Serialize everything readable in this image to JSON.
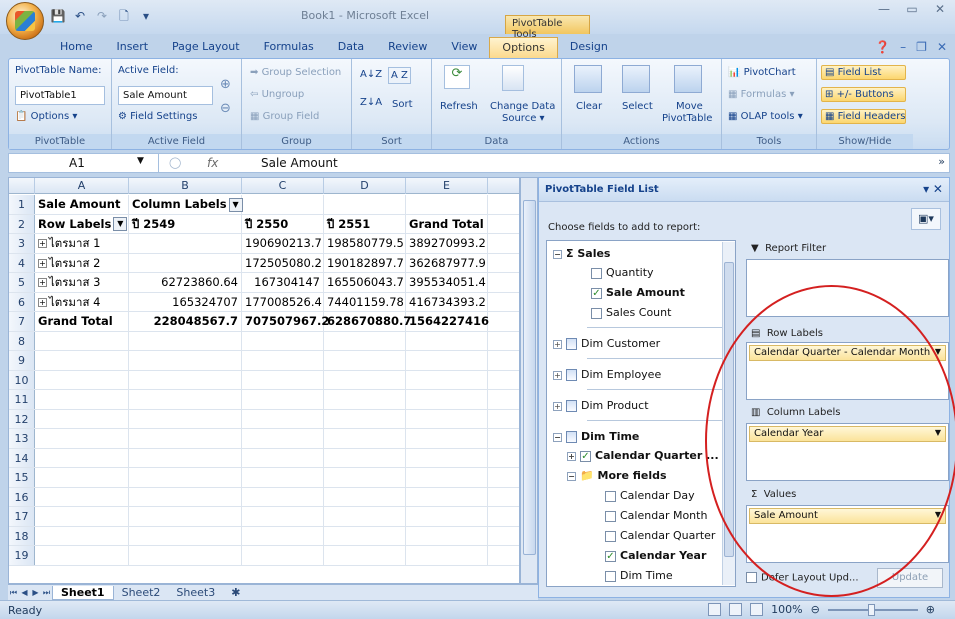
{
  "window": {
    "title": "Book1 - Microsoft Excel",
    "context_tab_header": "PivotTable Tools",
    "controls": [
      "—",
      "▭",
      "✕"
    ]
  },
  "tabs": [
    "Home",
    "Insert",
    "Page Layout",
    "Formulas",
    "Data",
    "Review",
    "View",
    "Options",
    "Design"
  ],
  "active_tab": "Options",
  "ribbon": {
    "pivottable": {
      "name_label": "PivotTable Name:",
      "name_value": "PivotTable1",
      "options_label": "Options",
      "group_label": "PivotTable"
    },
    "active_field": {
      "label": "Active Field:",
      "value": "Sale Amount",
      "settings_label": "Field Settings",
      "group_label": "Active Field"
    },
    "group": {
      "selection": "Group Selection",
      "ungroup": "Ungroup",
      "field": "Group Field",
      "group_label": "Group"
    },
    "sort": {
      "sort_label": "Sort",
      "group_label": "Sort"
    },
    "data": {
      "refresh": "Refresh",
      "change_source": "Change Data",
      "change_source_2": "Source",
      "group_label": "Data"
    },
    "actions": {
      "clear": "Clear",
      "select": "Select",
      "move": "Move",
      "move_2": "PivotTable",
      "group_label": "Actions"
    },
    "tools": {
      "pivotchart": "PivotChart",
      "formulas": "Formulas",
      "olap": "OLAP tools",
      "group_label": "Tools"
    },
    "showhide": {
      "field_list": "Field List",
      "buttons": "+/- Buttons",
      "headers": "Field Headers",
      "group_label": "Show/Hide"
    }
  },
  "formula_bar": {
    "name_box": "A1",
    "fx": "fx",
    "content": "Sale Amount"
  },
  "sheet": {
    "columns": [
      "A",
      "B",
      "C",
      "D",
      "E"
    ],
    "rows": [
      {
        "n": "1",
        "a": "Sale Amount",
        "b": "Column Labels",
        "c": "",
        "d": "",
        "e": ""
      },
      {
        "n": "2",
        "a": "Row Labels",
        "b": "ปี 2549",
        "c": "ปี 2550",
        "d": "ปี 2551",
        "e": "Grand Total"
      },
      {
        "n": "3",
        "a": "ไตรมาส 1",
        "b": "",
        "c": "190690213.7",
        "d": "198580779.5",
        "e": "389270993.2"
      },
      {
        "n": "4",
        "a": "ไตรมาส 2",
        "b": "",
        "c": "172505080.2",
        "d": "190182897.7",
        "e": "362687977.9"
      },
      {
        "n": "5",
        "a": "ไตรมาส 3",
        "b": "62723860.64",
        "c": "167304147",
        "d": "165506043.7",
        "e": "395534051.4"
      },
      {
        "n": "6",
        "a": "ไตรมาส 4",
        "b": "165324707",
        "c": "177008526.4",
        "d": "74401159.78",
        "e": "416734393.2"
      },
      {
        "n": "7",
        "a": "Grand Total",
        "b": "228048567.7",
        "c": "707507967.2",
        "d": "628670880.7",
        "e": "1564227416"
      }
    ],
    "empty_rows": [
      "8",
      "9",
      "10",
      "11",
      "12",
      "13",
      "14",
      "15",
      "16",
      "17",
      "18",
      "19"
    ],
    "tabs": [
      "Sheet1",
      "Sheet2",
      "Sheet3"
    ]
  },
  "status": {
    "text": "Ready",
    "zoom": "100%"
  },
  "field_pane": {
    "title": "PivotTable Field List",
    "choose_label": "Choose fields to add to report:",
    "sales_label": "Sales",
    "quantity": "Quantity",
    "sale_amount": "Sale Amount",
    "sales_count": "Sales Count",
    "dim_customer": "Dim Customer",
    "dim_employee": "Dim Employee",
    "dim_product": "Dim Product",
    "dim_time": "Dim Time",
    "calendar_quarter_hier": "Calendar Quarter ...",
    "more_fields": "More fields",
    "calendar_day": "Calendar Day",
    "calendar_month": "Calendar Month",
    "calendar_quarter": "Calendar Quarter",
    "calendar_year": "Calendar Year",
    "dim_time_attr": "Dim Time",
    "report_filter": "Report Filter",
    "row_labels": "Row Labels",
    "row_field": "Calendar Quarter - Calendar Month",
    "column_labels": "Column Labels",
    "column_field": "Calendar Year",
    "values": "Values",
    "values_field": "Sale Amount",
    "defer": "Defer Layout Upd...",
    "update": "Update"
  },
  "colors": {
    "annotation_circle": "#d42020",
    "selected_field_bg": "#fbe39a"
  }
}
